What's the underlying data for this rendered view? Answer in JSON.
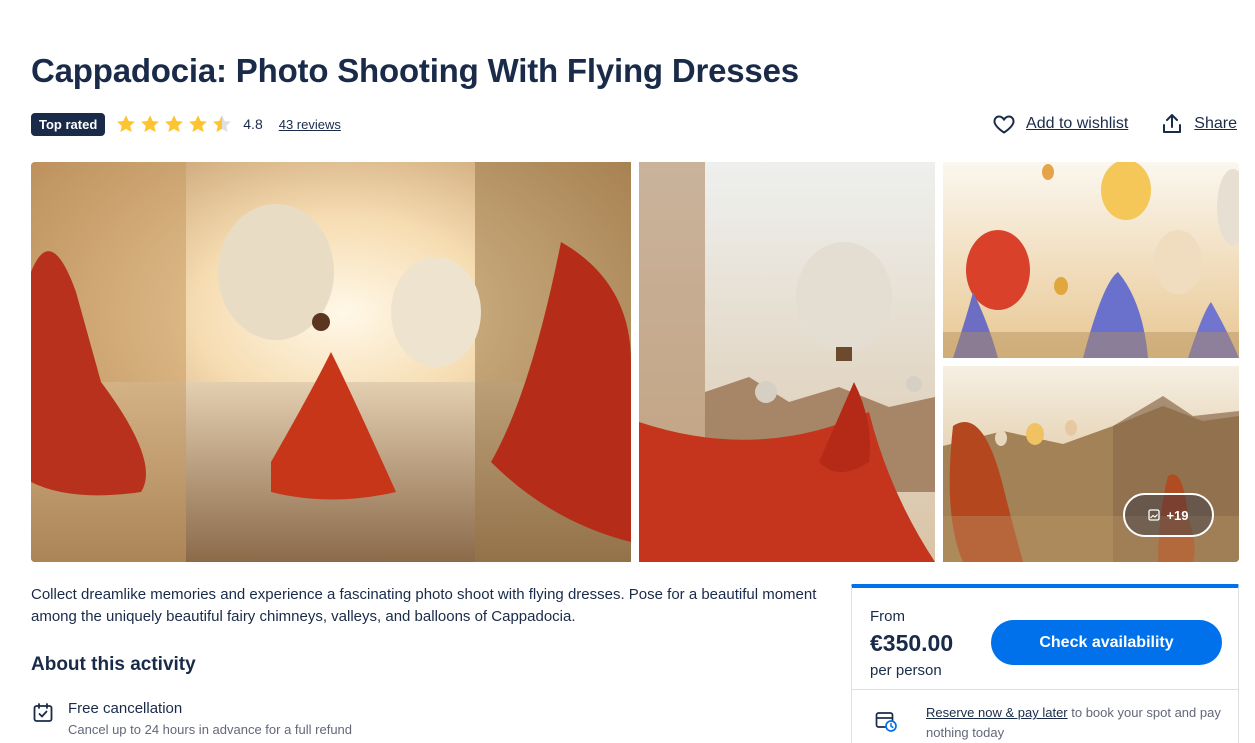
{
  "title": "Cappadocia: Photo Shooting With Flying Dresses",
  "badge": "Top rated",
  "rating": {
    "value": "4.8",
    "stars_filled": 4.5,
    "reviews_label": "43 reviews",
    "star_color": "#fdc42f"
  },
  "actions": {
    "wishlist_label": "Add to wishlist",
    "share_label": "Share"
  },
  "gallery": {
    "more_label": "+19",
    "images": [
      "photo-red-dress-sunrise",
      "photo-red-dress-balloon",
      "photo-blue-dress-balloons",
      "photo-orange-dress-valley"
    ]
  },
  "description": "Collect dreamlike memories and experience a fascinating photo shoot with flying dresses. Pose for a beautiful moment among the uniquely beautiful fairy chimneys, valleys, and balloons of Cappadocia.",
  "about": {
    "heading": "About this activity",
    "features": [
      {
        "icon": "calendar-check-icon",
        "title": "Free cancellation",
        "subtitle": "Cancel up to 24 hours in advance for a full refund"
      }
    ]
  },
  "booking": {
    "from_label": "From",
    "price": "€350.00",
    "per_label": "per person",
    "button_label": "Check availability",
    "reserve_link": "Reserve now & pay later",
    "reserve_rest": " to book your spot and pay nothing today",
    "accent": "#0071eb"
  }
}
